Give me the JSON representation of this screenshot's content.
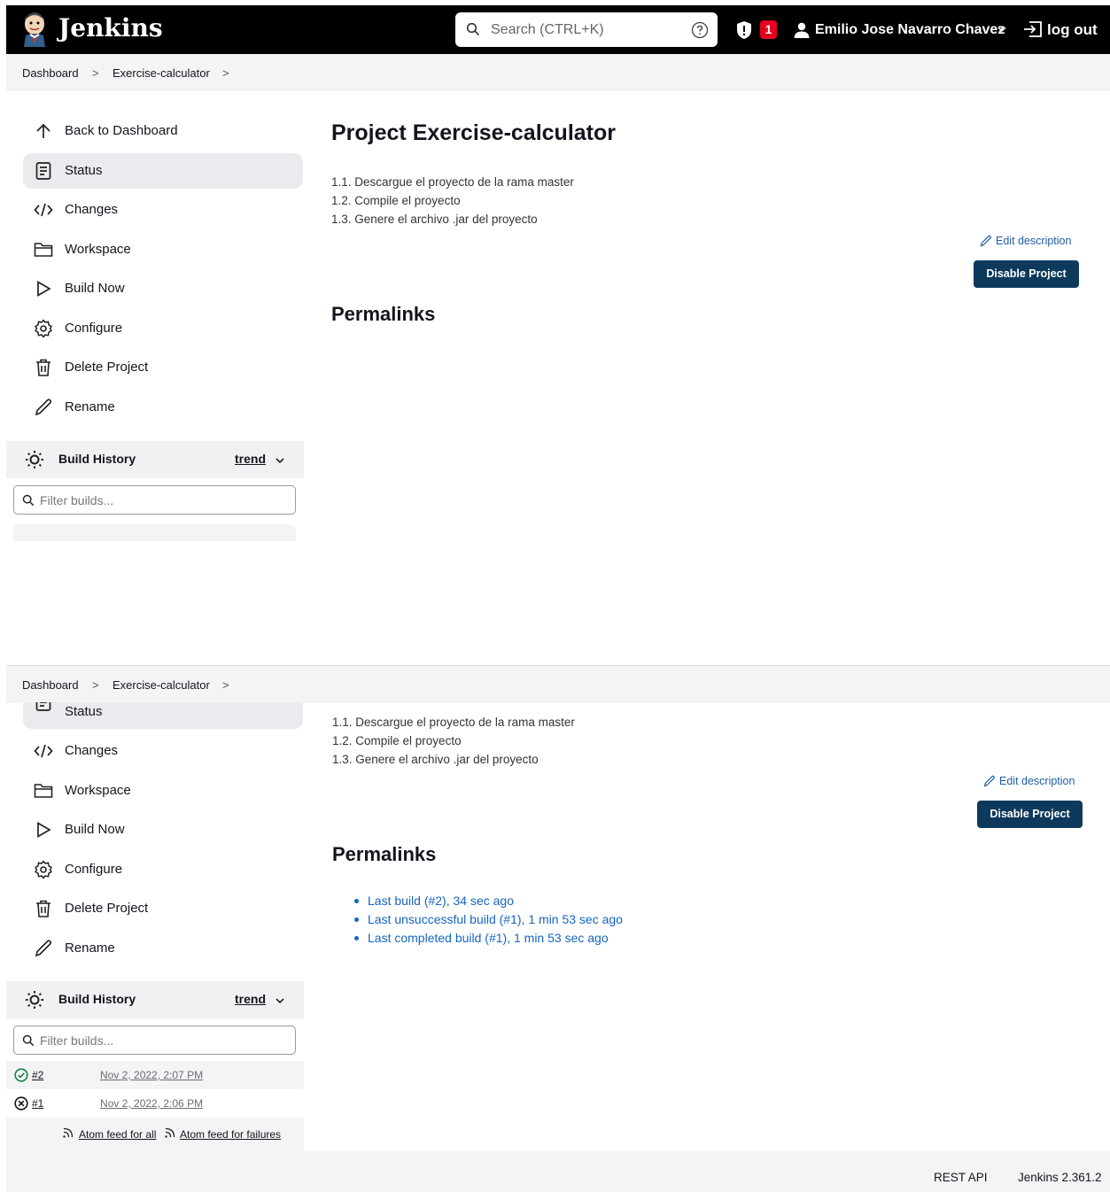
{
  "header": {
    "brand": "Jenkins",
    "search_placeholder": "Search (CTRL+K)",
    "security_badge_count": "1",
    "user_name": "Emilio Jose Navarro Chavez",
    "logout_label": "log out"
  },
  "breadcrumb": {
    "items": [
      "Dashboard",
      "Exercise-calculator"
    ],
    "separator": ">"
  },
  "sidebar": {
    "back": "Back to Dashboard",
    "items": [
      {
        "label": "Status",
        "icon": "document-icon"
      },
      {
        "label": "Changes",
        "icon": "code-icon"
      },
      {
        "label": "Workspace",
        "icon": "folder-icon"
      },
      {
        "label": "Build Now",
        "icon": "play-icon"
      },
      {
        "label": "Configure",
        "icon": "gear-icon"
      },
      {
        "label": "Delete Project",
        "icon": "trash-icon"
      },
      {
        "label": "Rename",
        "icon": "pencil-icon"
      }
    ]
  },
  "build_history": {
    "title": "Build History",
    "trend_label": "trend",
    "filter_placeholder": "Filter builds...",
    "builds": [
      {
        "number": "#2",
        "date": "Nov 2, 2022, 2:07 PM",
        "status": "success"
      },
      {
        "number": "#1",
        "date": "Nov 2, 2022, 2:06 PM",
        "status": "failed"
      }
    ],
    "atom_all": "Atom feed for all",
    "atom_failures": "Atom feed for failures"
  },
  "main": {
    "title": "Project Exercise-calculator",
    "description": [
      "1.1. Descargue el proyecto de la rama master",
      "1.2. Compile el proyecto",
      "1.3. Genere el archivo .jar del proyecto"
    ],
    "edit_description": "Edit description",
    "disable_button": "Disable Project",
    "permalinks_title": "Permalinks",
    "permalinks": [
      "Last build (#2), 34 sec ago",
      "Last unsuccessful build (#1), 1 min 53 sec ago",
      "Last completed build (#1), 1 min 53 sec ago"
    ]
  },
  "footer": {
    "rest_api": "REST API",
    "version": "Jenkins 2.361.2"
  },
  "colors": {
    "header_bg": "#000000",
    "button_bg": "#0d3a5c",
    "link": "#1565c0",
    "badge": "#e6001f"
  }
}
